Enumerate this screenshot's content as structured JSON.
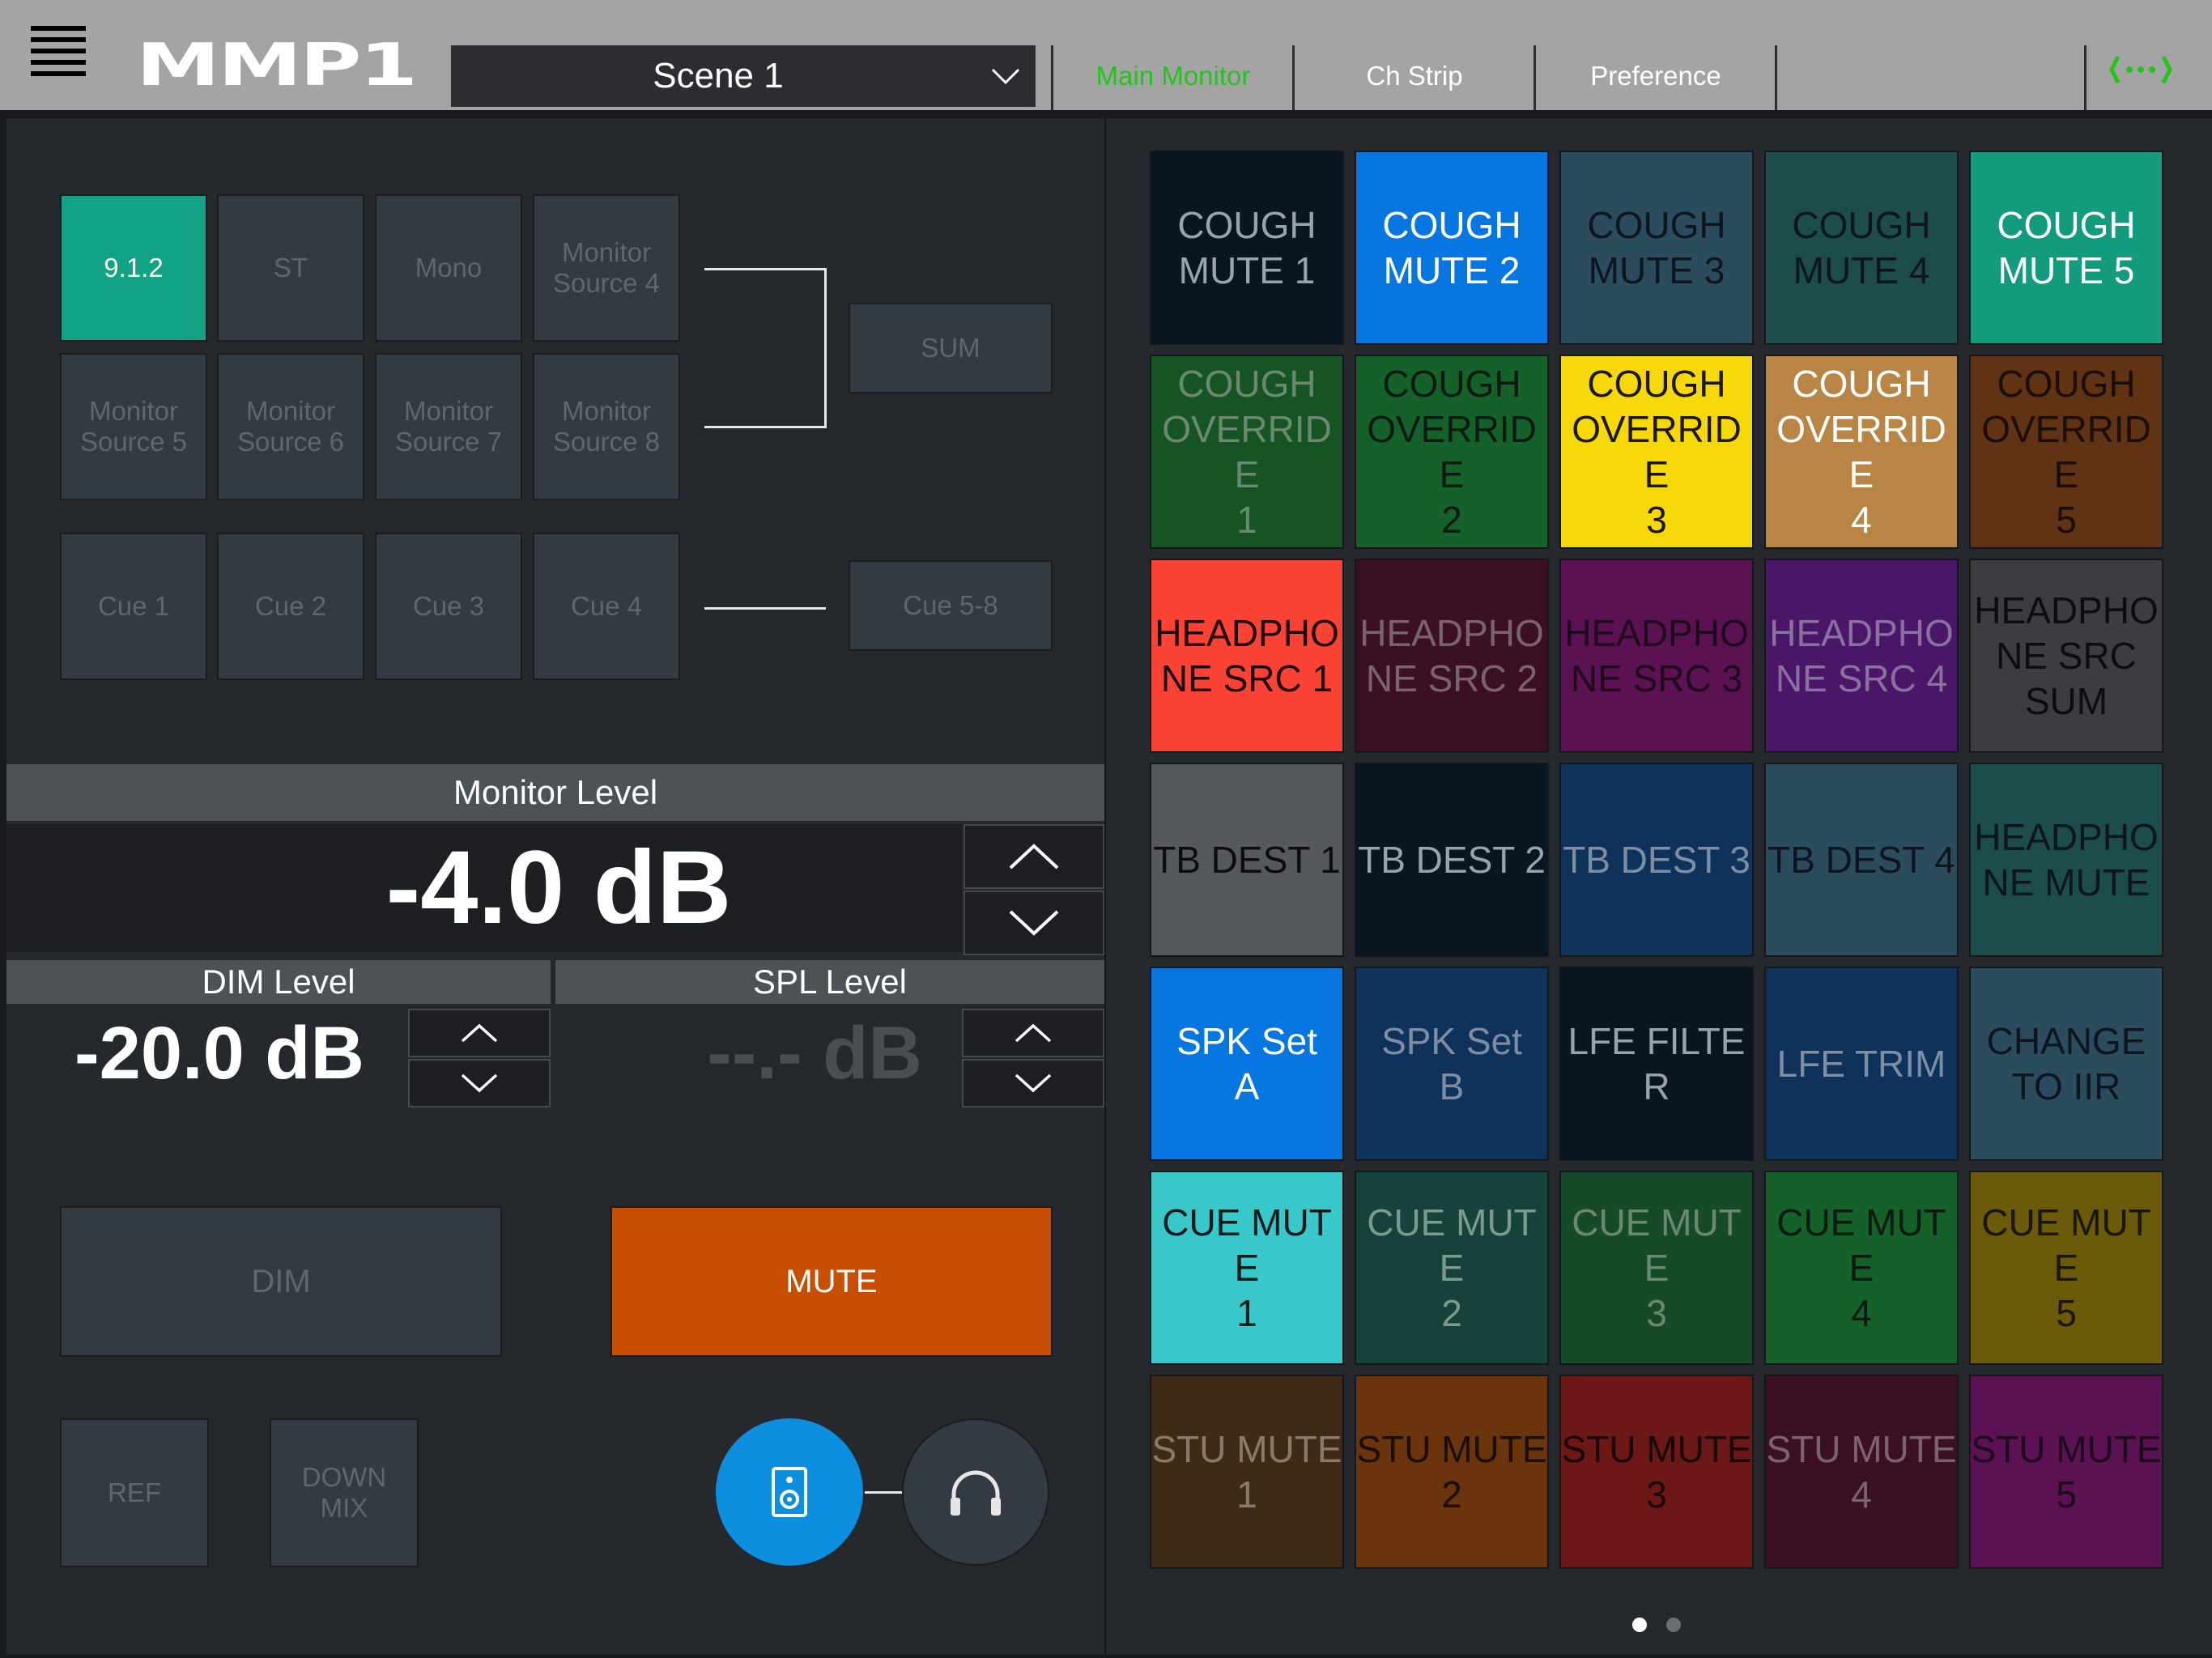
{
  "header": {
    "logo": "MMP1",
    "scene": "Scene 1",
    "tabs": [
      {
        "label": "Main Monitor",
        "color": "#22c51c"
      },
      {
        "label": "Ch Strip",
        "color": "#ffffff"
      },
      {
        "label": "Preference",
        "color": "#ffffff"
      }
    ],
    "link_icon_color": "#22c51c"
  },
  "sources": {
    "row1": [
      "9.1.2",
      "ST",
      "Mono",
      "Monitor\nSource 4"
    ],
    "row2": [
      "Monitor\nSource 5",
      "Monitor\nSource 6",
      "Monitor\nSource 7",
      "Monitor\nSource 8"
    ],
    "sum": "SUM",
    "cues": [
      "Cue 1",
      "Cue 2",
      "Cue 3",
      "Cue 4"
    ],
    "cue_group": "Cue 5-8",
    "active_color": "#12a384"
  },
  "monitor_level": {
    "label": "Monitor Level",
    "value": "-4.0 dB"
  },
  "dim_level": {
    "label": "DIM Level",
    "value": "-20.0 dB"
  },
  "spl_level": {
    "label": "SPL Level",
    "value": "--.- dB"
  },
  "buttons": {
    "dim": "DIM",
    "mute": "MUTE",
    "mute_color": "#c84e04",
    "ref": "REF",
    "downmix": "DOWN\nMIX",
    "speaker_color": "#0d8fe0"
  },
  "user_keys": [
    {
      "label": "COUGH\nMUTE 1",
      "bg": "#0a1522",
      "fg": "#9aa3ad"
    },
    {
      "label": "COUGH\nMUTE 2",
      "bg": "#0676e0",
      "fg": "#ffffff"
    },
    {
      "label": "COUGH\nMUTE 3",
      "bg": "#2b4c5c",
      "fg": "#0b1620"
    },
    {
      "label": "COUGH\nMUTE 4",
      "bg": "#1c4d4c",
      "fg": "#0b1620"
    },
    {
      "label": "COUGH\nMUTE 5",
      "bg": "#129b7c",
      "fg": "#ffffff"
    },
    {
      "label": "COUGH\nOVERRIDE\n1",
      "bg": "#175424",
      "fg": "#6a8a70"
    },
    {
      "label": "COUGH\nOVERRIDE\n2",
      "bg": "#15612a",
      "fg": "#0a1a10"
    },
    {
      "label": "COUGH\nOVERRIDE\n3",
      "bg": "#f6d809",
      "fg": "#1a1600"
    },
    {
      "label": "COUGH\nOVERRIDE\n4",
      "bg": "#b98545",
      "fg": "#ffffff"
    },
    {
      "label": "COUGH\nOVERRIDE\n5",
      "bg": "#5f3313",
      "fg": "#1a0e05"
    },
    {
      "label": "HEADPHO\nNE SRC 1",
      "bg": "#fa4335",
      "fg": "#1a0504"
    },
    {
      "label": "HEADPHO\nNE SRC 2",
      "bg": "#3b0f24",
      "fg": "#7a6270"
    },
    {
      "label": "HEADPHO\nNE SRC 3",
      "bg": "#5a1253",
      "fg": "#1e0a1c"
    },
    {
      "label": "HEADPHO\nNE SRC 4",
      "bg": "#4a1668",
      "fg": "#8a70a0"
    },
    {
      "label": "HEADPHO\nNE SRC\nSUM",
      "bg": "#3b3d40",
      "fg": "#0c0d0e"
    },
    {
      "label": "TB DEST 1",
      "bg": "#56595c",
      "fg": "#0c0d0e"
    },
    {
      "label": "TB DEST 2",
      "bg": "#0a1522",
      "fg": "#9aa3ad"
    },
    {
      "label": "TB DEST 3",
      "bg": "#0f325a",
      "fg": "#7d8ea4"
    },
    {
      "label": "TB DEST 4",
      "bg": "#2b4c5c",
      "fg": "#0b1620"
    },
    {
      "label": "HEADPHO\nNE MUTE",
      "bg": "#1c4d4c",
      "fg": "#0b1620"
    },
    {
      "label": "SPK Set\nA",
      "bg": "#0676e0",
      "fg": "#ffffff"
    },
    {
      "label": "SPK Set\nB",
      "bg": "#0f325a",
      "fg": "#7d8ea4"
    },
    {
      "label": "LFE FILTER",
      "bg": "#0a1522",
      "fg": "#9aa3ad"
    },
    {
      "label": "LFE TRIM",
      "bg": "#0f325a",
      "fg": "#7d8ea4"
    },
    {
      "label": "CHANGE\nTO IIR",
      "bg": "#2b4c5c",
      "fg": "#0b1620"
    },
    {
      "label": "CUE MUTE\n1",
      "bg": "#38c8c9",
      "fg": "#0a1a1a"
    },
    {
      "label": "CUE MUTE\n2",
      "bg": "#15423a",
      "fg": "#7a9a90"
    },
    {
      "label": "CUE MUTE\n3",
      "bg": "#174a26",
      "fg": "#6a8a70"
    },
    {
      "label": "CUE MUTE\n4",
      "bg": "#15612a",
      "fg": "#0a1a10"
    },
    {
      "label": "CUE MUTE\n5",
      "bg": "#6b5a0a",
      "fg": "#1a1600"
    },
    {
      "label": "STU MUTE\n1",
      "bg": "#3d2b15",
      "fg": "#8a7a6a"
    },
    {
      "label": "STU MUTE\n2",
      "bg": "#6a350c",
      "fg": "#1a0e05"
    },
    {
      "label": "STU MUTE\n3",
      "bg": "#6c1817",
      "fg": "#1a0504"
    },
    {
      "label": "STU MUTE\n4",
      "bg": "#3b0f24",
      "fg": "#7a6270"
    },
    {
      "label": "STU MUTE\n5",
      "bg": "#5a1253",
      "fg": "#1e0a1c"
    }
  ],
  "pager": {
    "pages": 2,
    "current": 1
  }
}
